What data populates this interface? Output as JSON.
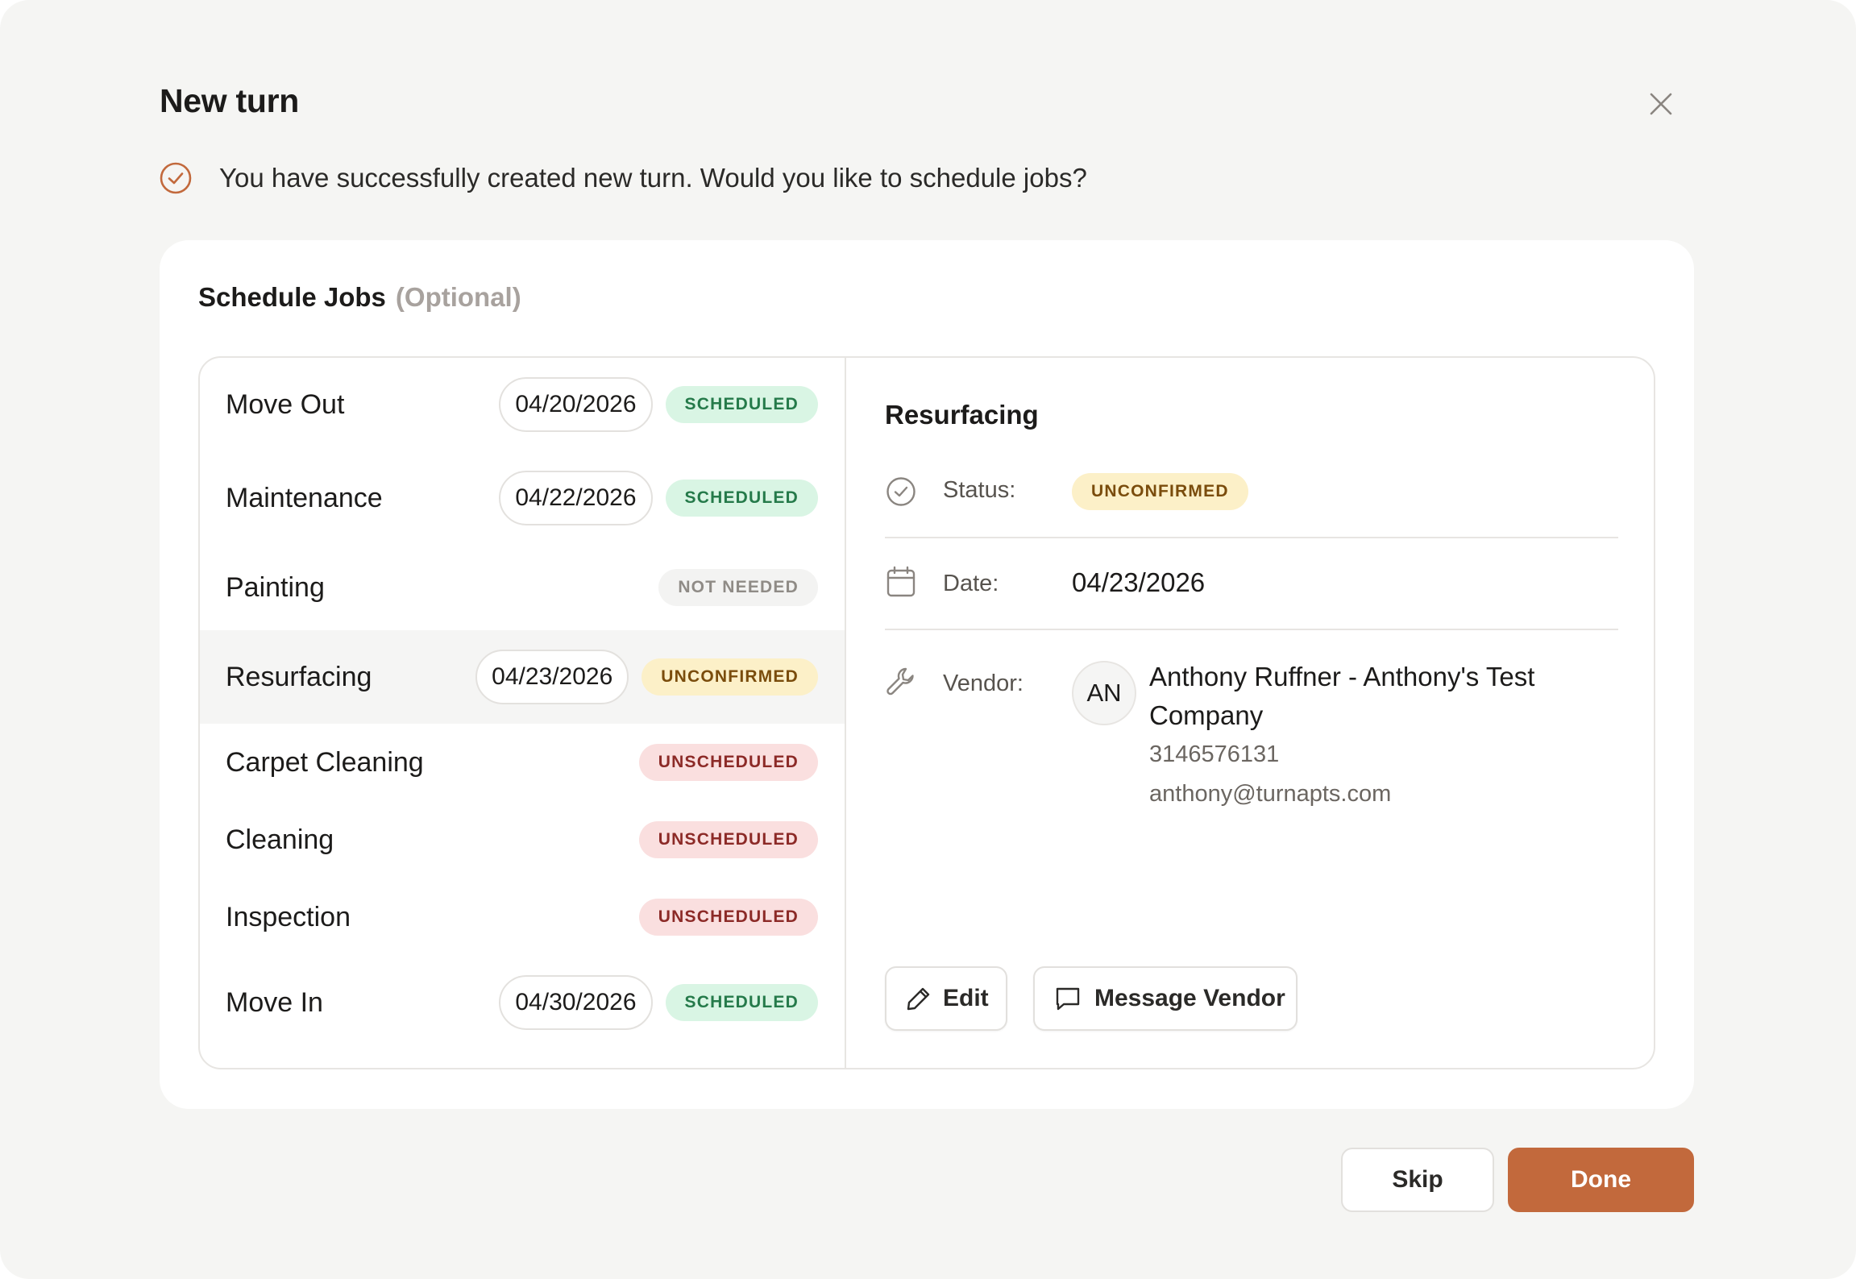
{
  "modal": {
    "title": "New turn",
    "success_message": "You have successfully created new turn. Would you like to schedule jobs?"
  },
  "schedule": {
    "heading": "Schedule Jobs",
    "optional_label": "(Optional)"
  },
  "jobs": [
    {
      "name": "Move Out",
      "date": "04/20/2026",
      "status": "SCHEDULED"
    },
    {
      "name": "Maintenance",
      "date": "04/22/2026",
      "status": "SCHEDULED"
    },
    {
      "name": "Painting",
      "date": "",
      "status": "NOT NEEDED"
    },
    {
      "name": "Resurfacing",
      "date": "04/23/2026",
      "status": "UNCONFIRMED"
    },
    {
      "name": "Carpet Cleaning",
      "date": "",
      "status": "UNSCHEDULED"
    },
    {
      "name": "Cleaning",
      "date": "",
      "status": "UNSCHEDULED"
    },
    {
      "name": "Inspection",
      "date": "",
      "status": "UNSCHEDULED"
    },
    {
      "name": "Move In",
      "date": "04/30/2026",
      "status": "SCHEDULED"
    }
  ],
  "detail": {
    "title": "Resurfacing",
    "status_label": "Status:",
    "status": "UNCONFIRMED",
    "date_label": "Date:",
    "date": "04/23/2026",
    "vendor_label": "Vendor:",
    "vendor": {
      "initials": "AN",
      "name": "Anthony Ruffner - Anthony's Test Company",
      "phone": "3146576131",
      "email": "anthony@turnapts.com"
    },
    "edit_label": "Edit",
    "message_label": "Message Vendor"
  },
  "footer": {
    "skip_label": "Skip",
    "done_label": "Done"
  },
  "colors": {
    "accent": "#c2693c",
    "scheduled_bg": "#d9f5e4",
    "unconfirmed_bg": "#fcf0c8",
    "unscheduled_bg": "#fadfdf"
  }
}
